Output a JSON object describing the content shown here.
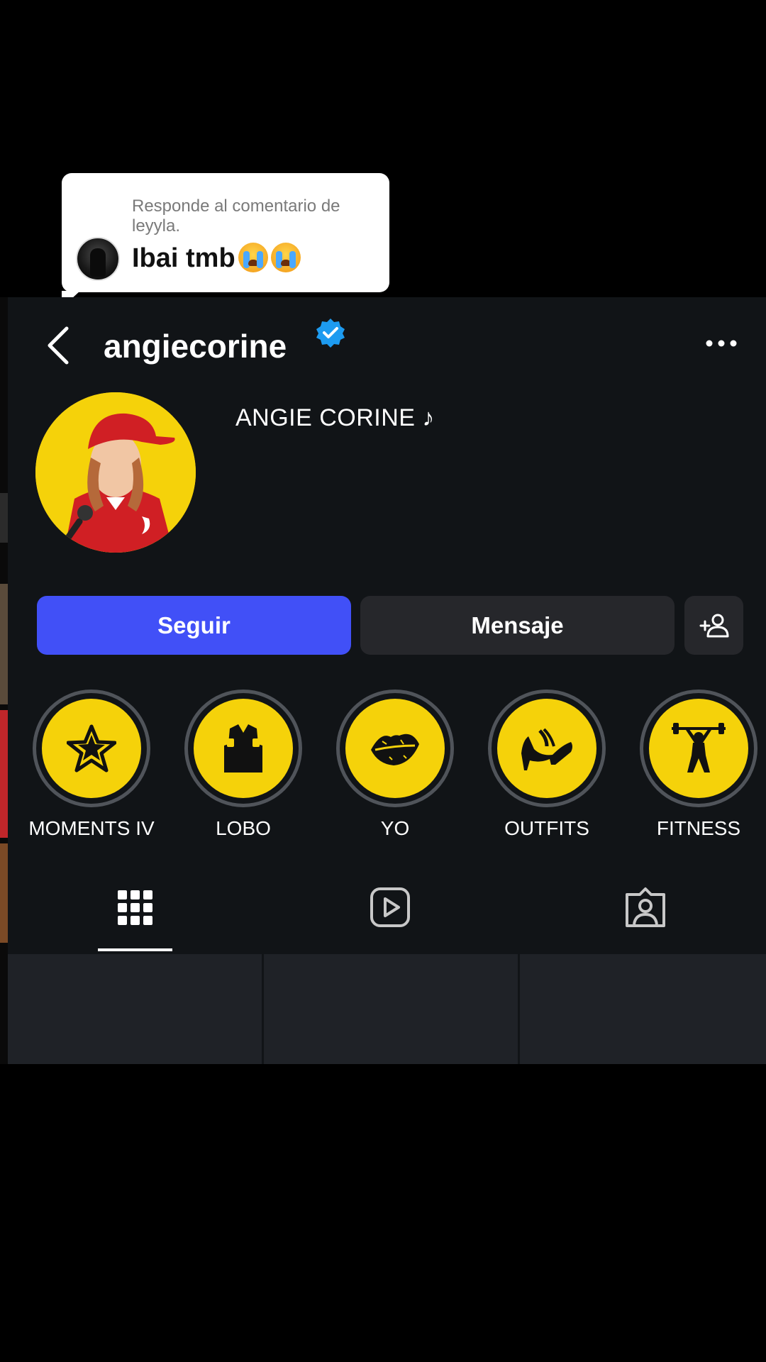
{
  "reply": {
    "caption": "Responde al comentario de leyyla.",
    "text": "Ibai tmb",
    "emoji": [
      "loudly-crying-face",
      "loudly-crying-face"
    ]
  },
  "profile": {
    "username": "angiecorine",
    "verified": true,
    "display_name": "ANGIE CORINE ♪"
  },
  "actions": {
    "follow_label": "Seguir",
    "message_label": "Mensaje"
  },
  "highlights": [
    {
      "label": "MOMENTS IV",
      "icon": "star-icon"
    },
    {
      "label": "LOBO",
      "icon": "jacket-icon"
    },
    {
      "label": "YO",
      "icon": "lips-icon"
    },
    {
      "label": "OUTFITS",
      "icon": "high-heel-icon"
    },
    {
      "label": "FITNESS",
      "icon": "weightlifter-icon"
    }
  ],
  "tabs": [
    {
      "icon": "grid-icon",
      "selected": true
    },
    {
      "icon": "reels-icon",
      "selected": false
    },
    {
      "icon": "tagged-icon",
      "selected": false
    }
  ],
  "colors": {
    "accent": "#4150f7",
    "highlight_fill": "#f5d20a",
    "verified": "#1d9bf0",
    "panel_bg": "#111417"
  }
}
